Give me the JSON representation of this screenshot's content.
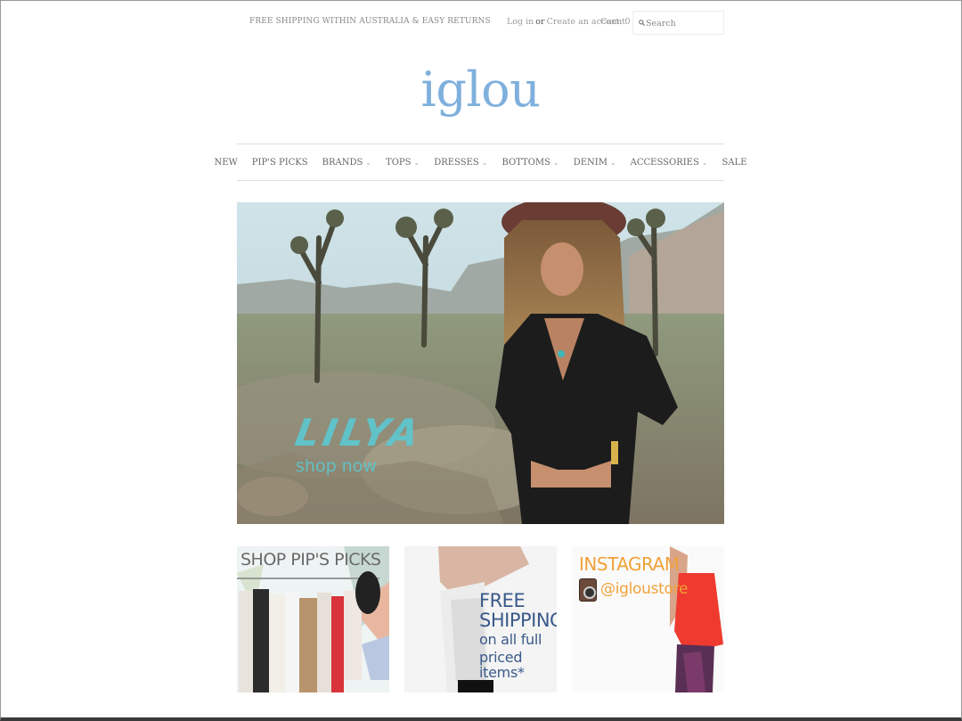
{
  "header": {
    "promo": "FREE SHIPPING WITHIN AUSTRALIA & EASY RETURNS",
    "login": "Log in",
    "or": "or",
    "create_account": "Create an account",
    "cart": "Cart: 0",
    "search_placeholder": "Search"
  },
  "logo": "iglou",
  "nav": [
    {
      "label": "NEW",
      "has_dropdown": false
    },
    {
      "label": "PIP'S PICKS",
      "has_dropdown": false
    },
    {
      "label": "BRANDS",
      "has_dropdown": true
    },
    {
      "label": "TOPS",
      "has_dropdown": true
    },
    {
      "label": "DRESSES",
      "has_dropdown": true
    },
    {
      "label": "BOTTOMS",
      "has_dropdown": true
    },
    {
      "label": "DENIM",
      "has_dropdown": true
    },
    {
      "label": "ACCESSORIES",
      "has_dropdown": true
    },
    {
      "label": "SALE",
      "has_dropdown": false
    }
  ],
  "hero": {
    "title": "LILYA",
    "cta": "shop now"
  },
  "tiles": {
    "pips_picks": {
      "title": "SHOP PIP'S PICKS"
    },
    "shipping": {
      "line1": "FREE",
      "line2": "SHIPPING",
      "line3": "on all full",
      "line4": "priced items*"
    },
    "instagram": {
      "title": "INSTAGRAM",
      "handle": "@igloustore"
    }
  },
  "colors": {
    "logo": "#7fb0dd",
    "hero_text": "#5ec7cf",
    "instagram_text": "#f0a23a",
    "shipping_text": "#3a5a8a"
  },
  "icons": {
    "search": "magnifier-icon",
    "instagram": "instagram-icon",
    "dropdown": "chevron-down-icon"
  }
}
